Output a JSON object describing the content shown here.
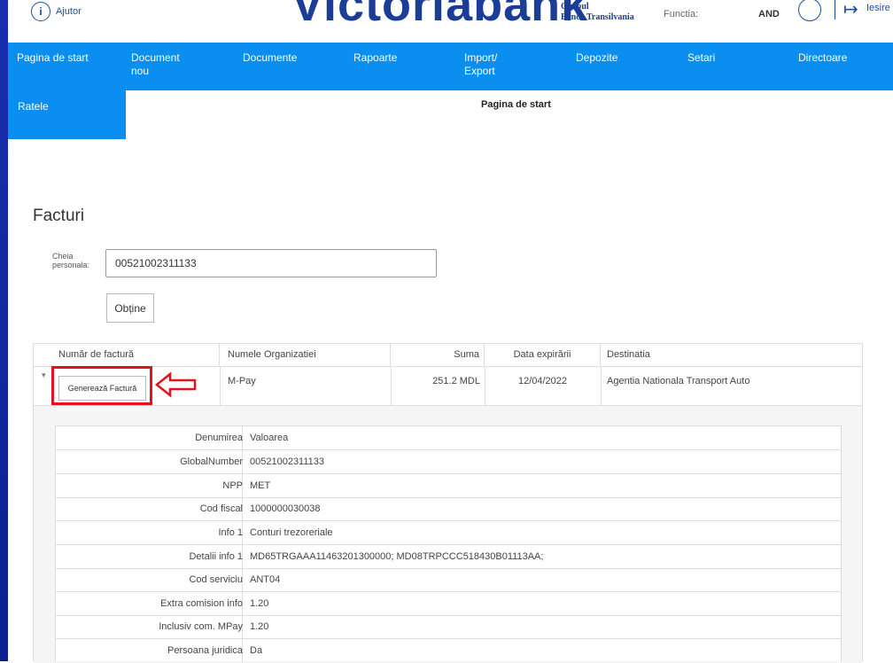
{
  "header": {
    "help_label": "Ajutor",
    "logo_text": "Victoriabank",
    "brand_group": "Grupul",
    "brand_name": "Banca Transilvania",
    "function_label": "Functia:",
    "function_value": "AND",
    "exit_label": "Iesire",
    "colors": {
      "brand": "#1b3d98",
      "nav": "#0a8ef0"
    }
  },
  "nav": {
    "items": [
      {
        "label": "Pagina de start"
      },
      {
        "label": "Document nou"
      },
      {
        "label": "Documente"
      },
      {
        "label": "Rapoarte"
      },
      {
        "label": "Import/ Export"
      },
      {
        "label": "Depozite"
      },
      {
        "label": "Setari"
      },
      {
        "label": "Directoare"
      }
    ]
  },
  "sidebar": {
    "items": [
      {
        "label": "Ratele"
      }
    ]
  },
  "breadcrumb": "Pagina de start",
  "page": {
    "title": "Facturi",
    "key_label": "Cheia personala:",
    "key_value": "00521002311133",
    "obtain_button": "Obține"
  },
  "invoices": {
    "columns": [
      "Număr de factură",
      "Numele Organizatiei",
      "Suma",
      "Data expirării",
      "Destinatia"
    ],
    "rows": [
      {
        "generate_button": "Generează Factură",
        "organization": "M-Pay",
        "amount": "251.2 MDL",
        "expiry": "12/04/2022",
        "destination": "Agentia Nationala Transport Auto"
      }
    ],
    "details": {
      "header_key": "Denumirea",
      "header_value": "Valoarea",
      "rows": [
        {
          "key": "GlobalNumber",
          "value": "00521002311133"
        },
        {
          "key": "NPP",
          "value": "MET"
        },
        {
          "key": "Cod fiscal",
          "value": "1000000030038"
        },
        {
          "key": "Info 1",
          "value": "Conturi trezoreriale"
        },
        {
          "key": "Detalii info 1",
          "value": "MD65TRGAAA11463201300000; MD08TRPCCC518430B01113AA;"
        },
        {
          "key": "Cod serviciu",
          "value": "ANT04"
        },
        {
          "key": "Extra comision info",
          "value": "1.20"
        },
        {
          "key": "Inclusiv com. MPay",
          "value": "1.20"
        },
        {
          "key": "Persoana juridica",
          "value": "Da"
        }
      ]
    }
  }
}
